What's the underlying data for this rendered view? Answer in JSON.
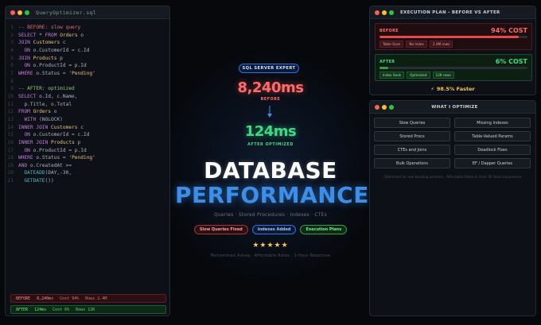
{
  "editor": {
    "filename": "QueryOptimizer.sql",
    "lines": [
      [
        {
          "t": "-- BEFORE: slow query",
          "c": "com"
        }
      ],
      [
        {
          "t": "SELECT",
          "c": "kw"
        },
        {
          "t": " * ",
          "c": "id"
        },
        {
          "t": "FROM",
          "c": "kw"
        },
        {
          "t": " ",
          "c": "id"
        },
        {
          "t": "Orders",
          "c": "tbl"
        },
        {
          "t": " o",
          "c": "id"
        }
      ],
      [
        {
          "t": "JOIN",
          "c": "kw"
        },
        {
          "t": " ",
          "c": "id"
        },
        {
          "t": "Customers",
          "c": "tbl"
        },
        {
          "t": " c",
          "c": "id"
        }
      ],
      [
        {
          "t": "  ",
          "c": "id"
        },
        {
          "t": "ON",
          "c": "kw"
        },
        {
          "t": " o.CustomerId = c.Id",
          "c": "id"
        }
      ],
      [
        {
          "t": "JOIN",
          "c": "kw"
        },
        {
          "t": " ",
          "c": "id"
        },
        {
          "t": "Products",
          "c": "tbl"
        },
        {
          "t": " p",
          "c": "id"
        }
      ],
      [
        {
          "t": "  ",
          "c": "id"
        },
        {
          "t": "ON",
          "c": "kw"
        },
        {
          "t": " o.ProductId = p.Id",
          "c": "id"
        }
      ],
      [
        {
          "t": "WHERE",
          "c": "kw"
        },
        {
          "t": " o.Status = ",
          "c": "id"
        },
        {
          "t": "'Pending'",
          "c": "str"
        }
      ],
      [
        {
          "t": "",
          "c": "id"
        }
      ],
      [
        {
          "t": "-- AFTER: optimized",
          "c": "comg"
        }
      ],
      [
        {
          "t": "SELECT",
          "c": "kw"
        },
        {
          "t": " o.Id, c.Name,",
          "c": "id"
        }
      ],
      [
        {
          "t": "  p.Title, o.Total",
          "c": "id"
        }
      ],
      [
        {
          "t": "FROM",
          "c": "kw"
        },
        {
          "t": " ",
          "c": "id"
        },
        {
          "t": "Orders",
          "c": "tbl"
        },
        {
          "t": " o",
          "c": "id"
        }
      ],
      [
        {
          "t": "  ",
          "c": "id"
        },
        {
          "t": "WITH",
          "c": "kw"
        },
        {
          "t": " (NOLOCK)",
          "c": "id"
        }
      ],
      [
        {
          "t": "INNER JOIN",
          "c": "kw"
        },
        {
          "t": " ",
          "c": "id"
        },
        {
          "t": "Customers",
          "c": "tbl"
        },
        {
          "t": " c",
          "c": "id"
        }
      ],
      [
        {
          "t": "  ",
          "c": "id"
        },
        {
          "t": "ON",
          "c": "kw"
        },
        {
          "t": " o.CustomerId = c.Id",
          "c": "id"
        }
      ],
      [
        {
          "t": "INNER JOIN",
          "c": "kw"
        },
        {
          "t": " ",
          "c": "id"
        },
        {
          "t": "Products",
          "c": "tbl"
        },
        {
          "t": " p",
          "c": "id"
        }
      ],
      [
        {
          "t": "  ",
          "c": "id"
        },
        {
          "t": "ON",
          "c": "kw"
        },
        {
          "t": " o.ProductId = p.Id",
          "c": "id"
        }
      ],
      [
        {
          "t": "WHERE",
          "c": "kw"
        },
        {
          "t": " o.Status = ",
          "c": "id"
        },
        {
          "t": "'Pending'",
          "c": "str"
        }
      ],
      [
        {
          "t": "AND",
          "c": "kw"
        },
        {
          "t": " o.CreatedAt >=",
          "c": "id"
        }
      ],
      [
        {
          "t": "  ",
          "c": "id"
        },
        {
          "t": "DATEADD",
          "c": "fn"
        },
        {
          "t": "(DAY,-30,",
          "c": "id"
        }
      ],
      [
        {
          "t": "  ",
          "c": "id"
        },
        {
          "t": "GETDATE",
          "c": "fn"
        },
        {
          "t": "())",
          "c": "id"
        }
      ]
    ],
    "metrics": {
      "before": {
        "label": "BEFORE",
        "time": "8,240ms",
        "cost": "Cost 94%",
        "rows": "Rows 2.4M"
      },
      "after": {
        "label": "AFTER",
        "time": "124ms",
        "cost": "Cost 6%",
        "rows": "Rows 12K"
      }
    }
  },
  "hero": {
    "badge": "SQL SERVER EXPERT",
    "before_time": "8,240ms",
    "before_label": "BEFORE",
    "after_time": "124ms",
    "after_label": "AFTER OPTIMIZED",
    "title_line1": "DATABASE",
    "title_line2": "PERFORMANCE",
    "subtitle": "Queries  ·  Stored Procedures  ·  Indexes  ·  CTEs",
    "pills": [
      {
        "label": "Slow Queries Fixed",
        "variant": "red"
      },
      {
        "label": "Indexes Added",
        "variant": "blue"
      },
      {
        "label": "Execution Plans",
        "variant": "green"
      }
    ],
    "stars": "★★★★★",
    "footer": "Muhammad Azhaq  ·  Affordable Rates  ·  1-Hour Response"
  },
  "plan": {
    "title": "EXECUTION PLAN - BEFORE VS AFTER",
    "before": {
      "label": "BEFORE",
      "pct_text": "94% COST",
      "fill": 0.94,
      "tags": [
        "Table Scan",
        "No Index",
        "2.4M rows"
      ]
    },
    "after": {
      "label": "AFTER",
      "pct_text": "6% COST",
      "fill": 0.06,
      "tags": [
        "Index Seek",
        "Optimized",
        "12K rows"
      ]
    },
    "faster": "98.5% Faster"
  },
  "optimize": {
    "title": "WHAT I OPTIMIZE",
    "items": [
      "Slow Queries",
      "Missing Indexes",
      "Stored Procs",
      "Table-Valued Params",
      "CTEs and Joins",
      "Deadlock Fixes",
      "Bulk Operations",
      "EF / Dapper Queries"
    ],
    "note": "Optimized for real banking systems  ·  Affordable Rates & Over 30 Years Experience"
  },
  "colors": {
    "accent_blue": "#3b8eea",
    "before_red": "#ff6b6b",
    "after_green": "#3ddc84",
    "star_gold": "#f2c94c"
  }
}
